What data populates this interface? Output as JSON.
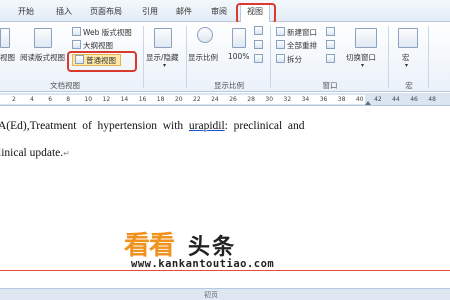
{
  "tabs": [
    "开始",
    "插入",
    "页面布局",
    "引用",
    "邮件",
    "审阅",
    "视图"
  ],
  "ribbon": {
    "doc_views": {
      "page_view": "视图",
      "reading_layout": "阅读版式视图",
      "web_layout": "Web 版式视图",
      "outline": "大纲视图",
      "draft": "普通视图",
      "group_label": "文档视图"
    },
    "show_hide": {
      "label": "显示/隐藏"
    },
    "zoom": {
      "zoom_label": "显示比例",
      "pct_label": "100%",
      "group_label": "显示比例"
    },
    "window": {
      "new_window": "新建窗口",
      "arrange_all": "全部重排",
      "split": "拆分",
      "switch_windows": "切换窗口",
      "group_label": "窗口"
    },
    "macros": {
      "label": "宏",
      "group_label": "宏"
    }
  },
  "ruler": [
    "2",
    "4",
    "6",
    "8",
    "10",
    "12",
    "14",
    "16",
    "18",
    "20",
    "22",
    "24",
    "26",
    "28",
    "30",
    "32",
    "34",
    "36",
    "38",
    "40",
    "42",
    "44",
    "46",
    "48"
  ],
  "document": {
    "line1_pre": "A(Ed),Treatment  of  hypertension  with  ",
    "line1_link": "urapidil",
    "line1_post": ":  preclinical  and",
    "line2": "linical update.",
    "para_mark": "↵"
  },
  "watermark": {
    "chars1": "看看",
    "chars2": "头条",
    "url": "www.kankantoutiao.com"
  },
  "status": {
    "text": "初页"
  }
}
